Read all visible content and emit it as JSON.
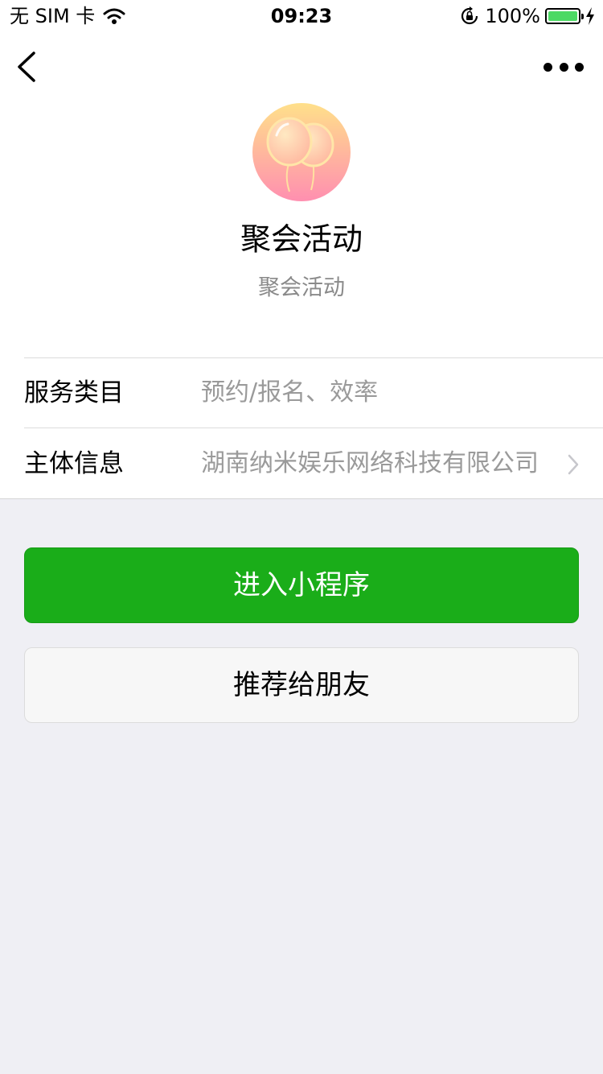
{
  "status_bar": {
    "carrier": "无 SIM 卡",
    "time": "09:23",
    "battery_percent": "100%",
    "battery_level": 1.0,
    "battery_color": "#4cd964"
  },
  "nav": {
    "back_icon": "chevron-left-icon",
    "more_icon": "more-dots-icon"
  },
  "profile": {
    "avatar_icon": "balloons-icon",
    "name": "聚会活动",
    "description": "聚会活动"
  },
  "info": {
    "rows": [
      {
        "label": "服务类目",
        "value": "预约/报名、效率"
      },
      {
        "label": "主体信息",
        "value": "湖南纳米娱乐网络科技有限公司"
      }
    ]
  },
  "actions": {
    "enter_label": "进入小程序",
    "share_label": "推荐给朋友"
  },
  "colors": {
    "primary": "#1aad19",
    "background": "#efeff4"
  }
}
